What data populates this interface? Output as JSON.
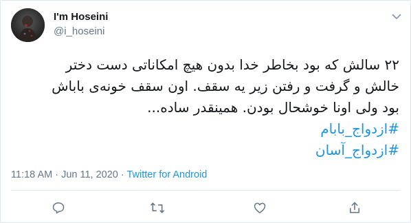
{
  "user": {
    "display_name": "I'm Hoseini",
    "handle": "@i_hoseini",
    "avatar_icon": "profile-photo"
  },
  "tweet": {
    "lines": [
      "۲۲ سالش که بود بخاطر خدا بدون هیچ امکاناتی دست دختر",
      "خالش و گرفت و رفتن زیر یه سقف. اون سقف خونه‌ی باباش",
      "بود ولی اونا خوشحال بودن. همینقدر ساده..."
    ],
    "hashtags": [
      "#ازدواج_بابام",
      "#ازدواج_آسان"
    ]
  },
  "meta": {
    "time": "11:18 AM",
    "separator1": " · ",
    "date": "Jun 11, 2020",
    "separator2": " · ",
    "source": "Twitter for Android"
  },
  "actions": [
    {
      "name": "reply",
      "icon": "comment-bubble-icon"
    },
    {
      "name": "retweet",
      "icon": "retweet-icon"
    },
    {
      "name": "like",
      "icon": "heart-icon"
    },
    {
      "name": "share",
      "icon": "share-icon"
    }
  ],
  "colors": {
    "text": "#14171a",
    "secondary": "#657786",
    "link": "#1b95e0",
    "border": "#e1e8ed"
  }
}
